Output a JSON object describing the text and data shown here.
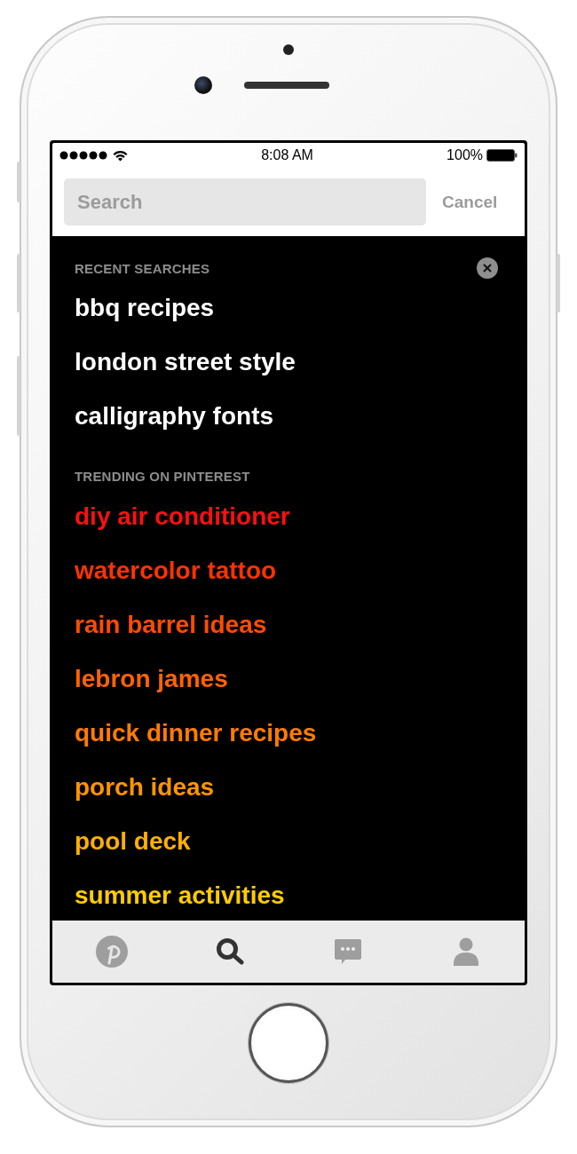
{
  "status_bar": {
    "time": "8:08 AM",
    "battery": "100%"
  },
  "search": {
    "placeholder": "Search",
    "cancel": "Cancel"
  },
  "recent": {
    "title": "RECENT SEARCHES",
    "items": [
      "bbq recipes",
      "london street style",
      "calligraphy fonts"
    ]
  },
  "trending": {
    "title": "TRENDING ON PINTEREST",
    "items": [
      {
        "label": "diy air conditioner",
        "color": "#ff1010"
      },
      {
        "label": "watercolor tattoo",
        "color": "#ff3300"
      },
      {
        "label": "rain barrel ideas",
        "color": "#ff4c00"
      },
      {
        "label": "lebron james",
        "color": "#ff6300"
      },
      {
        "label": "quick dinner recipes",
        "color": "#ff7c00"
      },
      {
        "label": "porch ideas",
        "color": "#ff9500"
      },
      {
        "label": "pool deck",
        "color": "#ffb000"
      },
      {
        "label": "summer activities",
        "color": "#ffcc00"
      }
    ]
  },
  "tab_bar": [
    {
      "kind": "home",
      "selected": false
    },
    {
      "kind": "search",
      "selected": true
    },
    {
      "kind": "messages",
      "selected": false
    },
    {
      "kind": "profile",
      "selected": false
    }
  ]
}
